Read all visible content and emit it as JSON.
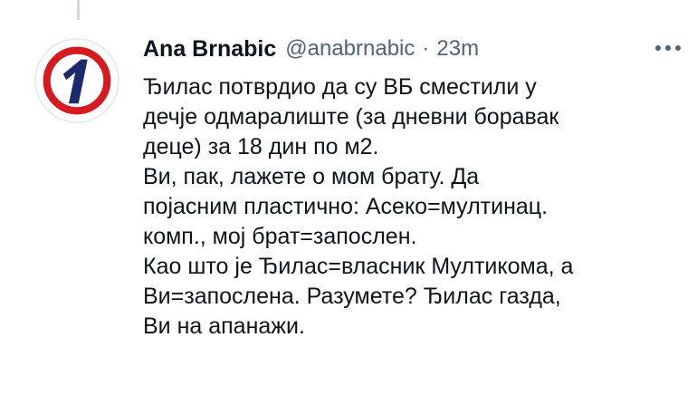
{
  "tweet": {
    "author": {
      "display_name": "Ana Brnabic",
      "handle": "@anabrnabic",
      "avatar_icon": "party-logo-1",
      "avatar_colors": {
        "ring": "#d71920",
        "numeral": "#1b2a6b"
      }
    },
    "separator": "·",
    "timestamp": "23m",
    "more_icon": "more-horizontal-icon",
    "body_lines": [
      "Ђилас потврдио да су ВБ сместили у",
      "дечје одмаралиште (за дневни боравак",
      "деце) за 18 дин по м2.",
      "Ви, пак, лажете о мом брату. Да",
      "појасним пластично: Асеко=мултинац.",
      "комп., мој брат=запослен.",
      "Као што је Ђилас=власник Мултикома, а",
      "Ви=запослена. Разумете? Ђилас газда,",
      "Ви на апанажи."
    ]
  },
  "colors": {
    "text_primary": "#0f1419",
    "text_secondary": "#536471",
    "thread_line": "#cfd9de"
  }
}
